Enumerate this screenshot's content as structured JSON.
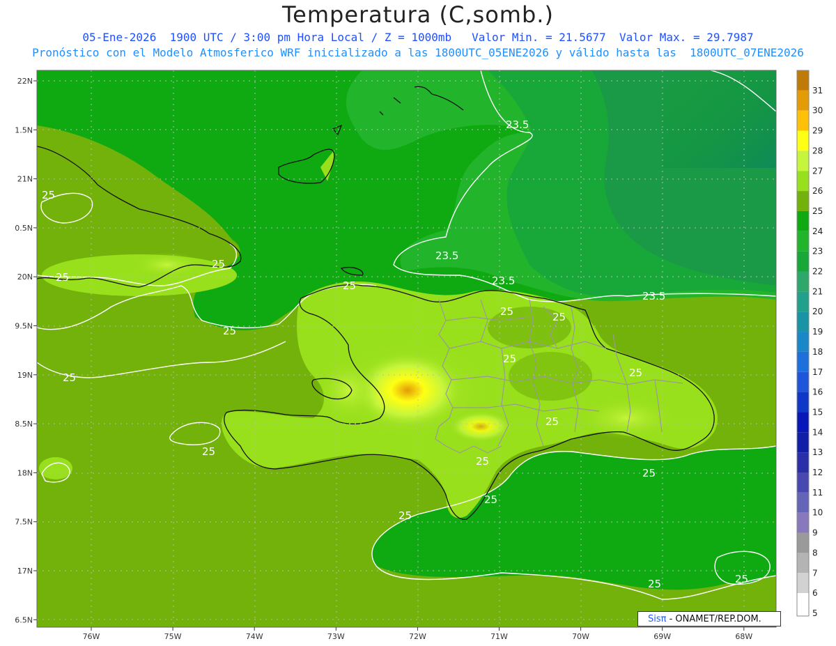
{
  "title": "Temperatura (C,somb.)",
  "subtitle_line1": "05-Ene-2026  1900 UTC / 3:00 pm Hora Local / Z = 1000mb   Valor Min. = 21.5677  Valor Max. = 29.7987",
  "subtitle_line2": "Pronóstico con el Modelo Atmosferico WRF inicializado a las 1800UTC_05ENE2026 y válido hasta las  1800UTC_07ENE2026",
  "credit": {
    "brand": "Sisπ",
    "text": " - ONAMET/REP.DOM."
  },
  "chart_data": {
    "type": "heatmap",
    "variable": "Temperatura",
    "units": "C",
    "level": "1000mb",
    "valid_time": "05-Ene-2026 1900 UTC",
    "min_value": 21.5677,
    "max_value": 29.7987,
    "lon_ticks": [
      "76W",
      "75W",
      "74W",
      "73W",
      "72W",
      "71W",
      "70W",
      "69W",
      "68W"
    ],
    "lat_ticks": [
      "22N",
      "1.5N",
      "21N",
      "0.5N",
      "20N",
      "9.5N",
      "19N",
      "8.5N",
      "18N",
      "7.5N",
      "17N",
      "6.5N"
    ],
    "colorbar": {
      "levels": [
        "31",
        "30",
        "29",
        "28",
        "27",
        "26",
        "25",
        "24",
        "23",
        "22",
        "21",
        "20",
        "19",
        "18",
        "17",
        "16",
        "15",
        "14",
        "13",
        "12",
        "11",
        "10",
        "9",
        "8",
        "7",
        "6",
        "5"
      ],
      "colors": [
        "#c07a08",
        "#e39b06",
        "#ffc107",
        "#ffff14",
        "#c5f53c",
        "#99e01c",
        "#72b20a",
        "#0faa12",
        "#22b52c",
        "#18a83a",
        "#2ea86a",
        "#21a08c",
        "#1894a4",
        "#1a88c8",
        "#1d6fdc",
        "#1f55d8",
        "#1038c8",
        "#0818b8",
        "#101ea8",
        "#2a2ea8",
        "#4848b0",
        "#6464b8",
        "#8a78bc",
        "#9a9a9a",
        "#b4b4b4",
        "#d2d2d2",
        "#ffffff"
      ]
    },
    "contour_labels": [
      "25",
      "25",
      "25",
      "25",
      "25",
      "25",
      "25",
      "25",
      "25",
      "25",
      "25",
      "25",
      "25",
      "25",
      "23.5",
      "23.5",
      "23.5",
      "23.5"
    ]
  }
}
